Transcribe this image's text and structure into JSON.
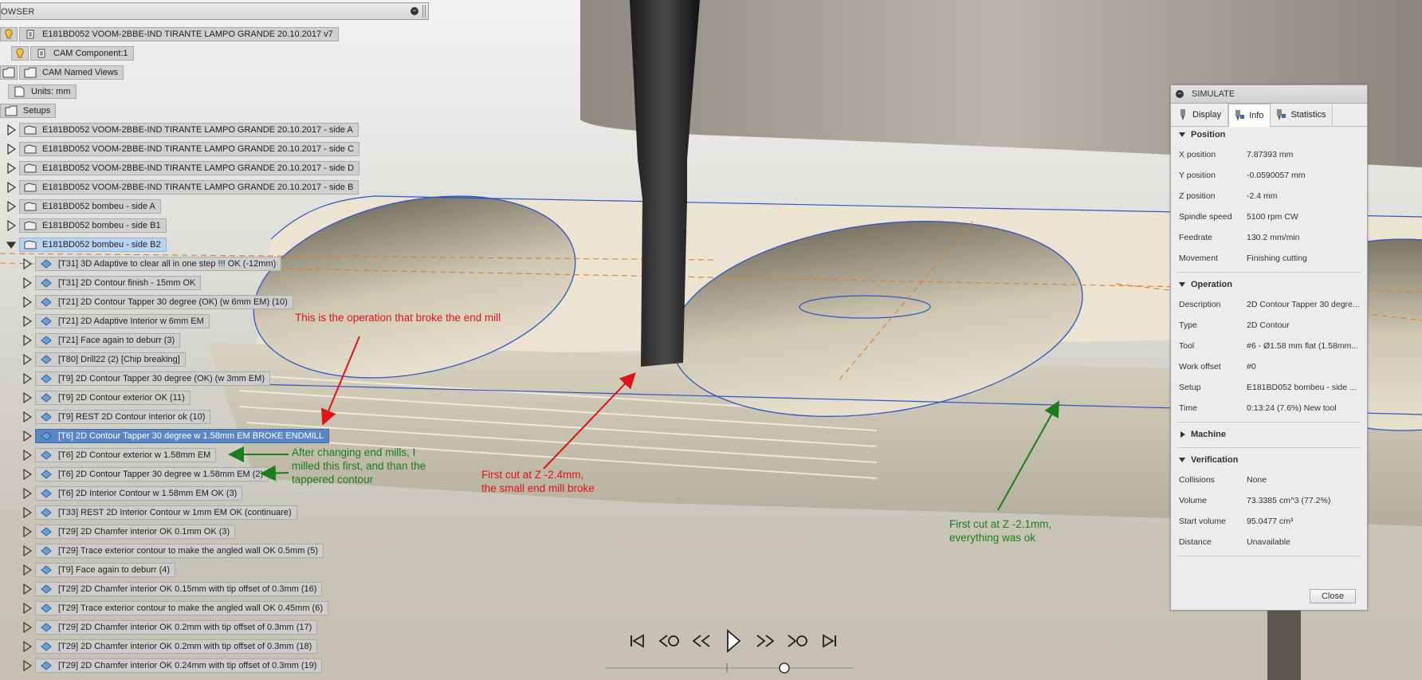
{
  "browser": {
    "header_title": "OWSER",
    "root": "E181BD052 VOOM-2BBE-IND TIRANTE LAMPO GRANDE 20.10.2017 v7",
    "cam_component": "CAM Component:1",
    "named_views": "CAM Named Views",
    "units": "Units: mm",
    "setups": "Setups",
    "setup_items": [
      "E181BD052 VOOM-2BBE-IND TIRANTE LAMPO GRANDE 20.10.2017 - side A",
      "E181BD052 VOOM-2BBE-IND TIRANTE LAMPO GRANDE 20.10.2017 - side C",
      "E181BD052 VOOM-2BBE-IND TIRANTE LAMPO GRANDE 20.10.2017 - side D",
      "E181BD052 VOOM-2BBE-IND TIRANTE LAMPO GRANDE 20.10.2017 - side B",
      "E181BD052 bombeu - side A",
      "E181BD052 bombeu - side B1",
      "E181BD052 bombeu - side B2"
    ],
    "operations": [
      "[T31] 3D Adaptive to clear all in one step !!! OK (-12mm)",
      "[T31] 2D Contour finish - 15mm OK",
      "[T21] 2D Contour Tapper 30 degree (OK) (w 6mm EM) (10)",
      "[T21] 2D Adaptive Interior w 6mm EM",
      "[T21] Face again to deburr (3)",
      "[T80] Drill22 (2) [Chip breaking]",
      "[T9] 2D Contour Tapper 30 degree (OK) (w 3mm EM)",
      "[T9] 2D Contour exterior OK (11)",
      "[T9] REST 2D Contour interior ok (10)",
      "[T6] 2D Contour Tapper 30 degree w 1.58mm EM BROKE ENDMILL",
      "[T6] 2D Contour exterior w 1.58mm EM",
      "[T6] 2D Contour Tapper 30 degree w 1.58mm EM (2)",
      "[T6] 2D Interior Contour w 1.58mm EM OK (3)",
      "[T33] REST 2D Interior Contour w 1mm EM OK (continuare)",
      "[T29] 2D Chamfer interior  OK 0.1mm OK (3)",
      "[T29] Trace exterior contour to make the angled wall OK 0.5mm (5)",
      "[T9] Face again to deburr (4)",
      "[T29] 2D Chamfer interior  OK 0.15mm with tip offset of 0.3mm (16)",
      "[T29] Trace exterior contour to make the angled wall OK 0.45mm (6)",
      "[T29] 2D Chamfer interior  OK 0.2mm with tip offset of 0.3mm (17)",
      "[T29] 2D Chamfer interior  OK 0.2mm with tip offset of 0.3mm (18)",
      "[T29] 2D Chamfer interior  OK 0.24mm with tip offset of 0.3mm (19)"
    ]
  },
  "simulate": {
    "title": "SIMULATE",
    "tabs": [
      "Display",
      "Info",
      "Statistics"
    ],
    "position": {
      "heading": "Position",
      "rows": [
        {
          "k": "X position",
          "v": "7.87393 mm"
        },
        {
          "k": "Y position",
          "v": "-0.0590057 mm"
        },
        {
          "k": "Z position",
          "v": "-2.4 mm"
        },
        {
          "k": "Spindle speed",
          "v": "5100 rpm CW"
        },
        {
          "k": "Feedrate",
          "v": "130.2 mm/min"
        },
        {
          "k": "Movement",
          "v": "Finishing cutting"
        }
      ]
    },
    "operation": {
      "heading": "Operation",
      "rows": [
        {
          "k": "Description",
          "v": "2D Contour Tapper 30 degre..."
        },
        {
          "k": "Type",
          "v": "2D Contour"
        },
        {
          "k": "Tool",
          "v": "#6 - Ø1.58 mm flat (1.58mm..."
        },
        {
          "k": "Work offset",
          "v": "#0"
        },
        {
          "k": "Setup",
          "v": "E181BD052 bombeu - side ..."
        },
        {
          "k": "Time",
          "v": "0:13:24 (7.6%) New tool"
        }
      ]
    },
    "machine": {
      "heading": "Machine"
    },
    "verification": {
      "heading": "Verification",
      "rows": [
        {
          "k": "Collisions",
          "v": "None"
        },
        {
          "k": "Volume",
          "v": "73.3385 cm^3 (77.2%)"
        },
        {
          "k": "Start volume",
          "v": "95.0477 cm³"
        },
        {
          "k": "Distance",
          "v": "Unavailable"
        }
      ]
    },
    "close_label": "Close"
  },
  "annotations": {
    "broke_op": "This is the operation that broke the end mill",
    "after_change_1": "After changing end mills, I",
    "after_change_2": "milled this first, and than the",
    "after_change_3": "tappered contour",
    "first_cut_24_1": "First cut at Z -2.4mm,",
    "first_cut_24_2": "the small end mill broke",
    "first_cut_21_1": "First cut at Z -2.1mm,",
    "first_cut_21_2": "everything was ok"
  },
  "playback": {
    "buttons": [
      "skip-to-start-icon",
      "previous-operation-icon",
      "step-back-icon",
      "play-icon",
      "step-forward-icon",
      "next-operation-icon",
      "skip-to-end-icon"
    ]
  },
  "colors": {
    "annotation_red": "#e01414",
    "annotation_green": "#1b7d1b",
    "selection_blue": "#5b86c4",
    "toolpath_blue": "#2a56c8",
    "toolpath_orange": "#e07a2a"
  }
}
